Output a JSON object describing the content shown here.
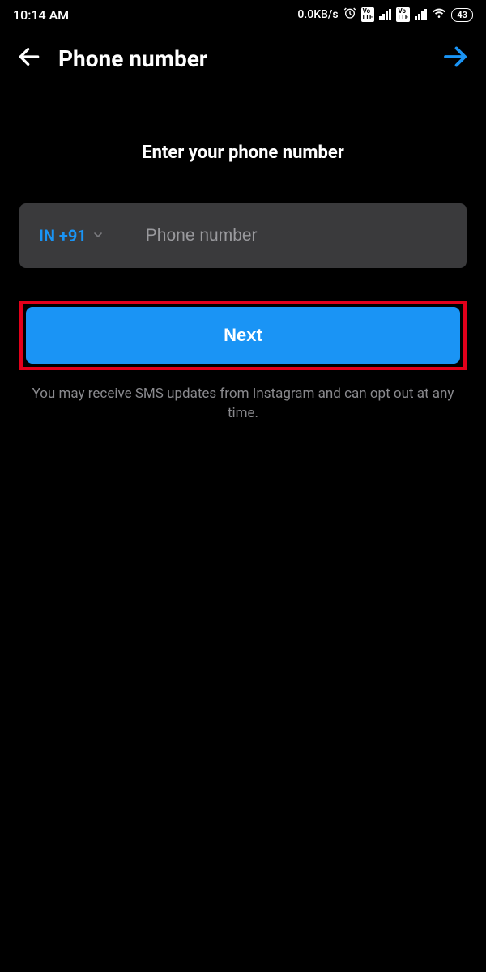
{
  "status_bar": {
    "time": "10:14 AM",
    "data_rate": "0.0KB/s",
    "battery_text": "43"
  },
  "header": {
    "title": "Phone number"
  },
  "main": {
    "subtitle": "Enter your phone number",
    "country_code": "IN +91",
    "phone_placeholder": "Phone number",
    "phone_value": "",
    "next_label": "Next",
    "disclaimer": "You may receive SMS updates from Instagram and can opt out at any time."
  }
}
